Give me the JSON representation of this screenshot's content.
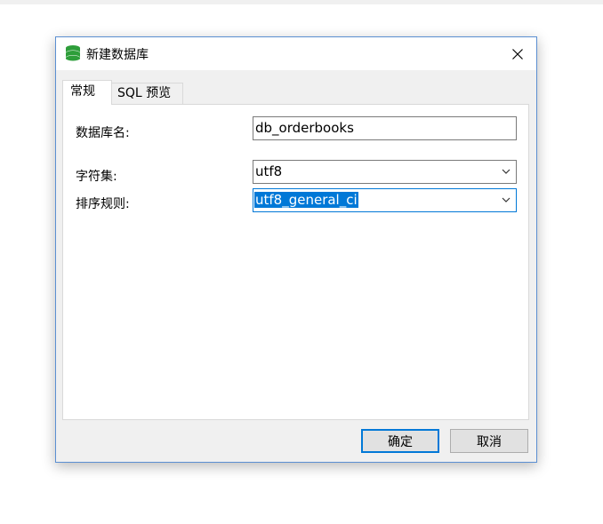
{
  "window": {
    "title": "新建数据库"
  },
  "tabs": [
    {
      "label": "常规"
    },
    {
      "label": "SQL 预览"
    }
  ],
  "form": {
    "db_name": {
      "label": "数据库名:",
      "value": "db_orderbooks"
    },
    "charset": {
      "label": "字符集:",
      "value": "utf8"
    },
    "collation": {
      "label": "排序规则:",
      "value": "utf8_general_ci"
    }
  },
  "buttons": {
    "ok": "确定",
    "cancel": "取消"
  },
  "icons": {
    "title": "database-icon",
    "close": "close-icon",
    "dropdown": "chevron-down-icon"
  },
  "colors": {
    "accent": "#0078d7",
    "db_icon": "#2e9e3a"
  }
}
